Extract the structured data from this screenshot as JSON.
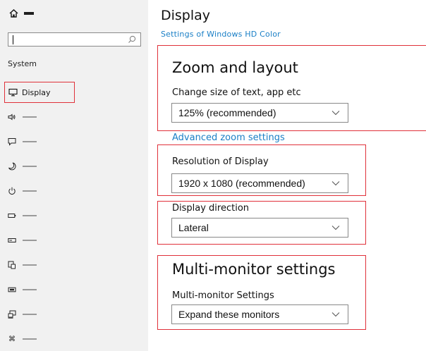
{
  "sidebar": {
    "search_placeholder": "",
    "section_label": "System",
    "display_label": "Display",
    "items": [
      {
        "icon": "speaker-icon"
      },
      {
        "icon": "notification-icon"
      },
      {
        "icon": "moon-icon"
      },
      {
        "icon": "power-icon"
      },
      {
        "icon": "battery-icon"
      },
      {
        "icon": "storage-icon"
      },
      {
        "icon": "tablet-icon"
      },
      {
        "icon": "multitask-icon"
      },
      {
        "icon": "project-icon"
      },
      {
        "icon": "shared-icon"
      }
    ]
  },
  "main": {
    "title": "Display",
    "hd_color_link": "Settings of Windows HD Color",
    "zoom": {
      "title": "Zoom and layout",
      "label": "Change  size of  text, app etc",
      "value": "125% (recommended)",
      "advanced_link": "Advanced zoom settings"
    },
    "resolution": {
      "label": "Resolution of Display",
      "value": "1920 x 1080  (recommended)"
    },
    "direction": {
      "label": "Display direction",
      "value": "Lateral"
    },
    "multi": {
      "title": "Multi-monitor settings",
      "label": "Multi-monitor Settings",
      "value": "Expand  these monitors"
    }
  },
  "colors": {
    "highlight": "#e0313a",
    "link": "#1a7fc6",
    "sidebar_bg": "#f1f1f1"
  }
}
